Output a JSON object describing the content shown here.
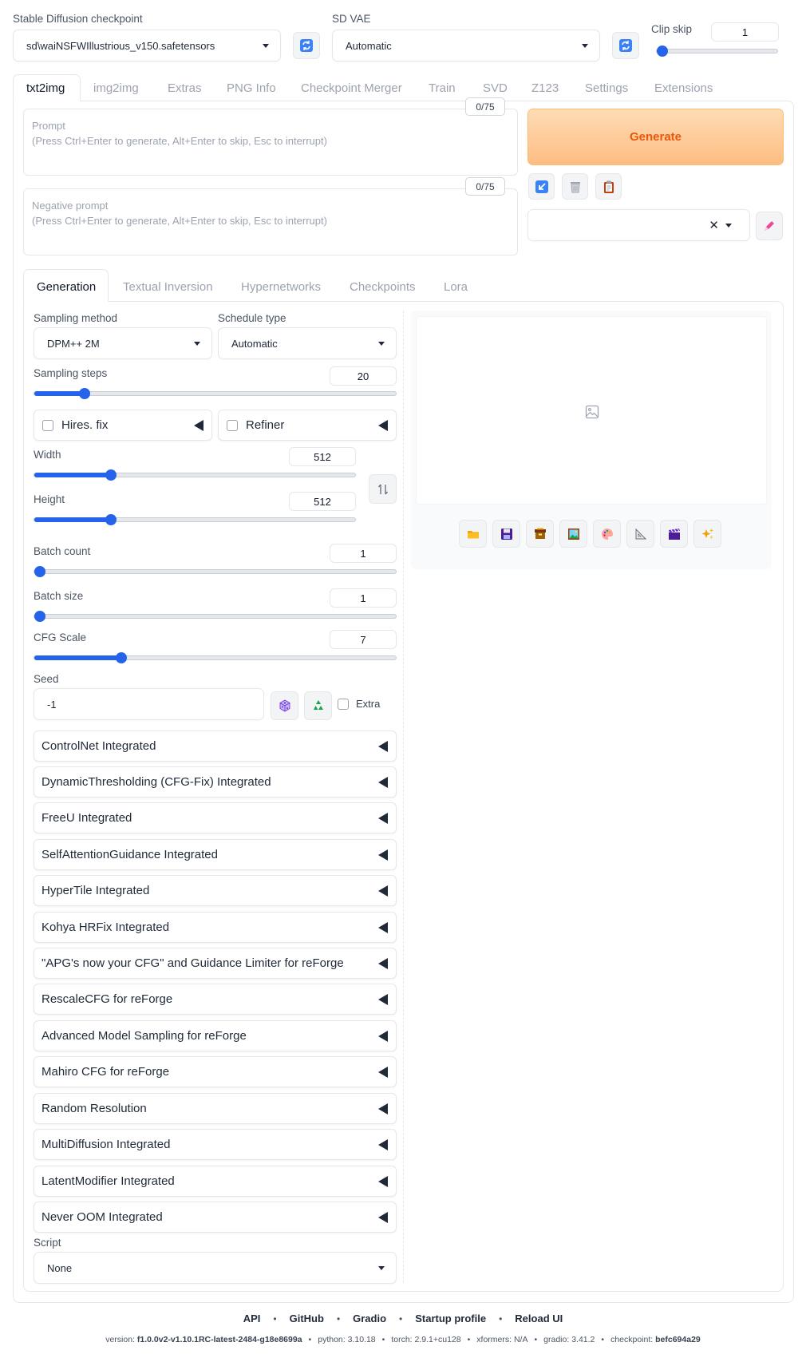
{
  "header": {
    "checkpoint_label": "Stable Diffusion checkpoint",
    "checkpoint_value": "sd\\waiNSFWIllustrious_v150.safetensors",
    "vae_label": "SD VAE",
    "vae_value": "Automatic",
    "clip_skip_label": "Clip skip",
    "clip_skip_value": "1",
    "clip_skip_fraction": 0.0
  },
  "tabs": [
    "txt2img",
    "img2img",
    "Extras",
    "PNG Info",
    "Checkpoint Merger",
    "Train",
    "SVD",
    "Z123",
    "Settings",
    "Extensions"
  ],
  "prompt": {
    "label": "Prompt",
    "placeholder": "(Press Ctrl+Enter to generate, Alt+Enter to skip, Esc to interrupt)",
    "counter": "0/75"
  },
  "negative_prompt": {
    "label": "Negative prompt",
    "placeholder": "(Press Ctrl+Enter to generate, Alt+Enter to skip, Esc to interrupt)",
    "counter": "0/75"
  },
  "generate_label": "Generate",
  "subtabs": [
    "Generation",
    "Textual Inversion",
    "Hypernetworks",
    "Checkpoints",
    "Lora"
  ],
  "generation": {
    "sampling_method_label": "Sampling method",
    "sampling_method_value": "DPM++ 2M",
    "schedule_type_label": "Schedule type",
    "schedule_type_value": "Automatic",
    "sampling_steps_label": "Sampling steps",
    "sampling_steps_value": "20",
    "sampling_steps_fraction": 0.14,
    "hires_fix_label": "Hires. fix",
    "refiner_label": "Refiner",
    "width_label": "Width",
    "width_value": "512",
    "width_fraction": 0.24,
    "height_label": "Height",
    "height_value": "512",
    "height_fraction": 0.24,
    "batch_count_label": "Batch count",
    "batch_count_value": "1",
    "batch_count_fraction": 0.0,
    "batch_size_label": "Batch size",
    "batch_size_value": "1",
    "batch_size_fraction": 0.0,
    "cfg_label": "CFG Scale",
    "cfg_value": "7",
    "cfg_fraction": 0.24,
    "seed_label": "Seed",
    "seed_value": "-1",
    "extra_label": "Extra"
  },
  "accordions": [
    "ControlNet Integrated",
    "DynamicThresholding (CFG-Fix) Integrated",
    "FreeU Integrated",
    "SelfAttentionGuidance Integrated",
    "HyperTile Integrated",
    "Kohya HRFix Integrated",
    "\"APG's now your CFG\" and Guidance Limiter for reForge",
    "RescaleCFG for reForge",
    "Advanced Model Sampling for reForge",
    "Mahiro CFG for reForge",
    "Random Resolution",
    "MultiDiffusion Integrated",
    "LatentModifier Integrated",
    "Never OOM Integrated"
  ],
  "script": {
    "label": "Script",
    "value": "None"
  },
  "footer": {
    "links": [
      "API",
      "GitHub",
      "Gradio",
      "Startup profile",
      "Reload UI"
    ],
    "version_label": "version:",
    "version_value": "f1.0.0v2-v1.10.1RC-latest-2484-g18e8699a",
    "python_label": "python: 3.10.18",
    "torch_label": "torch: 2.9.1+cu128",
    "xformers_label": "xformers: N/A",
    "gradio_label": "gradio: 3.41.2",
    "checkpoint_label": "checkpoint:",
    "checkpoint_value": "befc694a29"
  },
  "colors": {
    "accent": "#2563eb",
    "generate_from": "#fdd9b0",
    "generate_to": "#fdba7a",
    "generate_text": "#ea580c"
  }
}
